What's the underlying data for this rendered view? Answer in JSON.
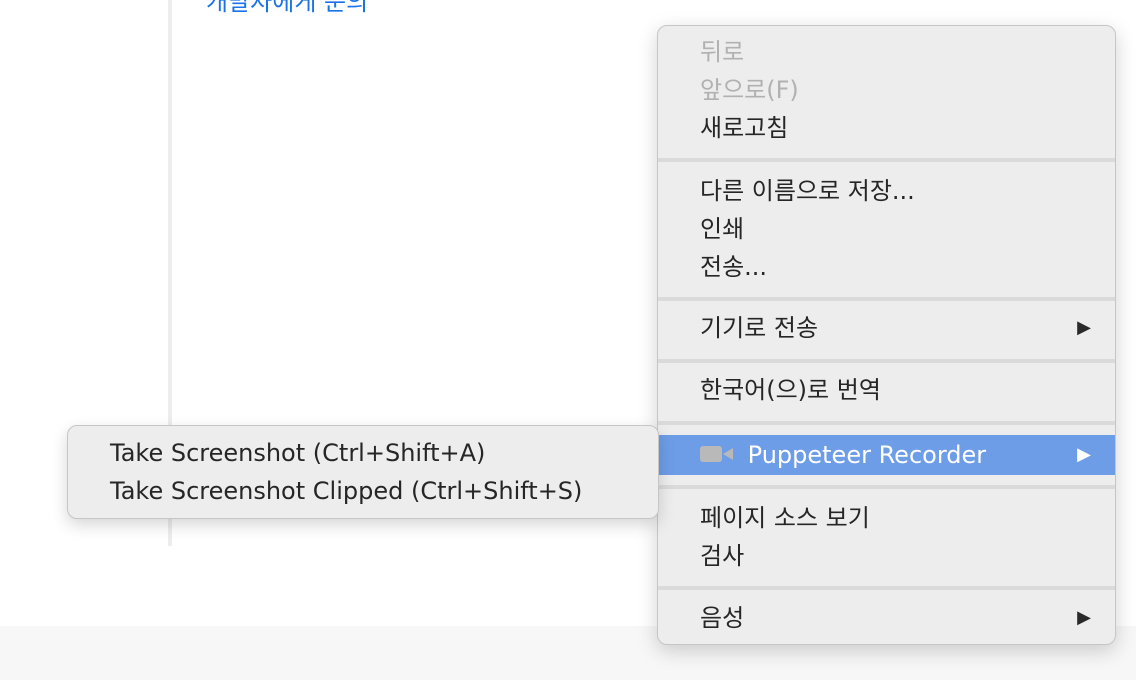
{
  "page": {
    "link_text": "개발자에게 문의"
  },
  "context_menu": {
    "items": [
      {
        "label": "뒤로",
        "disabled": true
      },
      {
        "label": "앞으로(F)",
        "disabled": true
      },
      {
        "label": "새로고침",
        "disabled": false
      },
      {
        "label": "다른 이름으로 저장...",
        "disabled": false
      },
      {
        "label": "인쇄",
        "disabled": false
      },
      {
        "label": "전송...",
        "disabled": false
      },
      {
        "label": "기기로 전송",
        "disabled": false,
        "submenu": true
      },
      {
        "label": "한국어(으)로 번역",
        "disabled": false
      },
      {
        "label": "Puppeteer Recorder",
        "disabled": false,
        "submenu": true,
        "highlighted": true,
        "icon": "camera-icon"
      },
      {
        "label": "페이지 소스 보기",
        "disabled": false
      },
      {
        "label": "검사",
        "disabled": false
      },
      {
        "label": "음성",
        "disabled": false,
        "submenu": true
      }
    ],
    "submenu_arrow": "▶"
  },
  "submenu": {
    "items": [
      {
        "label": "Take Screenshot (Ctrl+Shift+A)"
      },
      {
        "label": "Take Screenshot Clipped (Ctrl+Shift+S)"
      }
    ]
  },
  "colors": {
    "highlight": "#6d9de6",
    "menu_bg": "#ededed",
    "disabled_text": "#b1b1b1",
    "link": "#1a73e8"
  }
}
